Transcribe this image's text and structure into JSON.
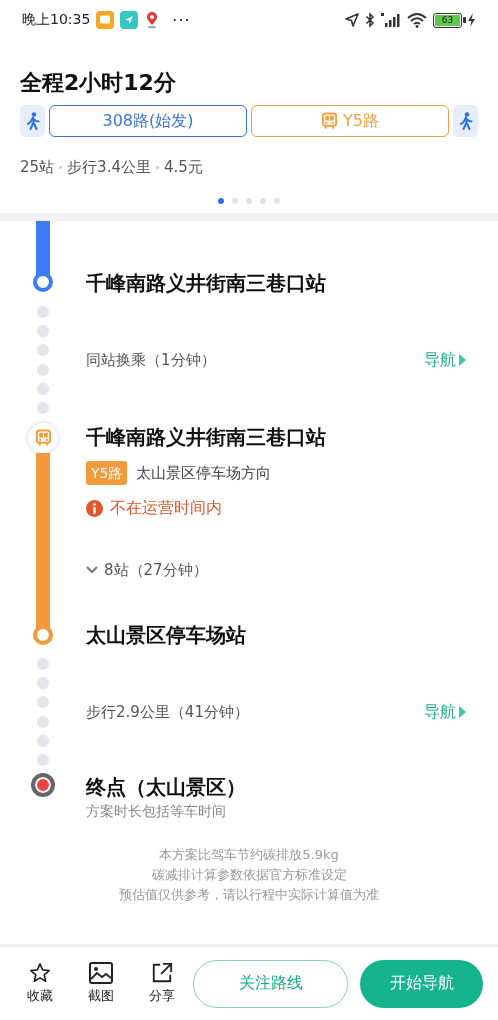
{
  "status_bar": {
    "time": "晚上10:35",
    "notifications": [
      {
        "kind": "chat",
        "color": "#f5a623"
      },
      {
        "kind": "nav",
        "color": "#35c6c0"
      },
      {
        "kind": "pin",
        "color": "#e23b3b"
      }
    ],
    "more": "···",
    "battery": "63"
  },
  "summary": {
    "title": "全程2小时12分",
    "legs": [
      {
        "kind": "walk"
      },
      {
        "kind": "route",
        "label": "308路(始发)",
        "color": "#3a75d6",
        "bus_icon": false
      },
      {
        "kind": "route",
        "label": "Y5路",
        "color": "#f0a040",
        "bus_icon": true
      },
      {
        "kind": "walk"
      }
    ],
    "stats": [
      "25站",
      "步行3.4公里",
      "4.5元"
    ],
    "pages": [
      {
        "selected": true
      },
      {
        "selected": false
      },
      {
        "selected": false
      },
      {
        "selected": false
      },
      {
        "selected": false
      }
    ]
  },
  "timeline": [
    {
      "kind": "ride_end",
      "color": "#3d7cf2",
      "station": "千峰南路义井街南三巷口站"
    },
    {
      "kind": "walk",
      "text": "同站换乘（1分钟）",
      "action": "导航"
    },
    {
      "kind": "ride",
      "color": "#f39a3a",
      "station": "千峰南路义井街南三巷口站",
      "route": "Y5路",
      "direction": "太山景区停车场方向",
      "warning": "不在运营时间内",
      "stops": "8站（27分钟）",
      "end_station": "太山景区停车场站"
    },
    {
      "kind": "walk",
      "text": "步行2.9公里（41分钟）",
      "action": "导航"
    },
    {
      "kind": "destination",
      "name": "终点（太山景区）",
      "note": "方案时长包括等车时间"
    }
  ],
  "carbon_note": [
    "本方案比驾车节约碳排放5.9kg",
    "碳减排计算参数依据官方标准设定",
    "预估值仅供参考，请以行程中实际计算值为准"
  ],
  "actions": [
    {
      "kind": "favorite",
      "label": "收藏"
    },
    {
      "kind": "screenshot",
      "label": "截图"
    },
    {
      "kind": "share",
      "label": "分享"
    }
  ],
  "buttons": [
    {
      "kind": "outline",
      "label": "关注路线"
    },
    {
      "kind": "primary",
      "label": "开始导航"
    }
  ]
}
